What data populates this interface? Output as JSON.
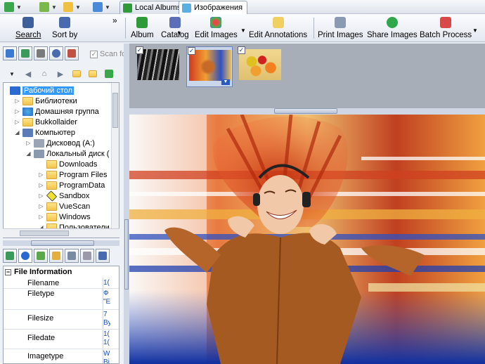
{
  "tabs": [
    {
      "label": "Local Albums"
    },
    {
      "label": "Изображения"
    }
  ],
  "toolbar_left": [
    {
      "label": "Search"
    },
    {
      "label": "Sort by"
    }
  ],
  "toolbar_main": [
    {
      "label": "Album"
    },
    {
      "label": "Catalog"
    },
    {
      "label": "Edit Images"
    },
    {
      "label": "Edit Annotations"
    },
    {
      "label": "Print Images"
    },
    {
      "label": "Share Images"
    },
    {
      "label": "Batch Process"
    }
  ],
  "overflow": "»",
  "scan_checkbox": {
    "label": "Scan fo"
  },
  "tree": [
    {
      "label": "Рабочий стол",
      "selected": true
    },
    {
      "label": "Библиотеки"
    },
    {
      "label": "Домашняя группа"
    },
    {
      "label": "Bukkollaider"
    },
    {
      "label": "Компьютер"
    },
    {
      "label": "Дисковод (A:)"
    },
    {
      "label": "Локальный диск ("
    },
    {
      "label": "Downloads"
    },
    {
      "label": "Program Files"
    },
    {
      "label": "ProgramData"
    },
    {
      "label": "Sandbox"
    },
    {
      "label": "VueScan"
    },
    {
      "label": "Windows"
    },
    {
      "label": "Пользователи"
    }
  ],
  "info": {
    "header": "File Information",
    "rows": [
      {
        "key": "Filename",
        "value": "1("
      },
      {
        "key": "Filetype",
        "value": "Ф \"E"
      },
      {
        "key": "Filesize",
        "value": "7 By"
      },
      {
        "key": "Filedate",
        "value": "1( 1("
      },
      {
        "key": "Imagetype",
        "value": "W Bi"
      }
    ]
  },
  "colors": {
    "accent": "#3a5fa8",
    "selection": "#cad6ea",
    "tree_selected": "#3399ff"
  }
}
